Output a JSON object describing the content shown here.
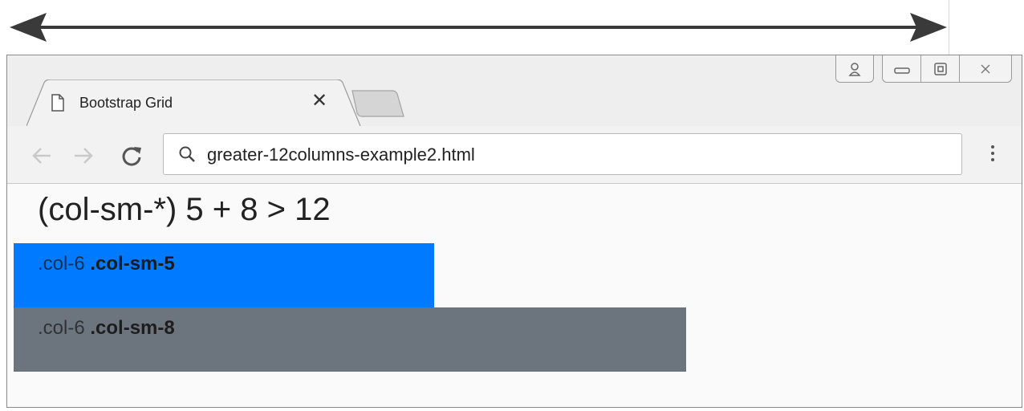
{
  "window": {
    "tab_title": "Bootstrap Grid",
    "close_tab_glyph": "✕",
    "url": "greater-12columns-example2.html"
  },
  "page": {
    "heading": "(col-sm-*) 5 + 8 > 12",
    "columns": [
      {
        "prefix": ".col-6",
        "bold": ".col-sm-5",
        "color": "#007bff"
      },
      {
        "prefix": ".col-6",
        "bold": ".col-sm-8",
        "color": "#6c757d"
      }
    ]
  },
  "icons": {
    "width_arrow": "double-headed-arrow-icon",
    "profile": "profile-icon",
    "minimize": "minimize-icon",
    "maximize": "maximize-icon",
    "close": "close-window-icon",
    "tab_doc": "document-icon",
    "back": "back-arrow-icon",
    "forward": "forward-arrow-icon",
    "reload": "reload-icon",
    "search": "search-icon",
    "menu": "kebab-menu-icon"
  }
}
